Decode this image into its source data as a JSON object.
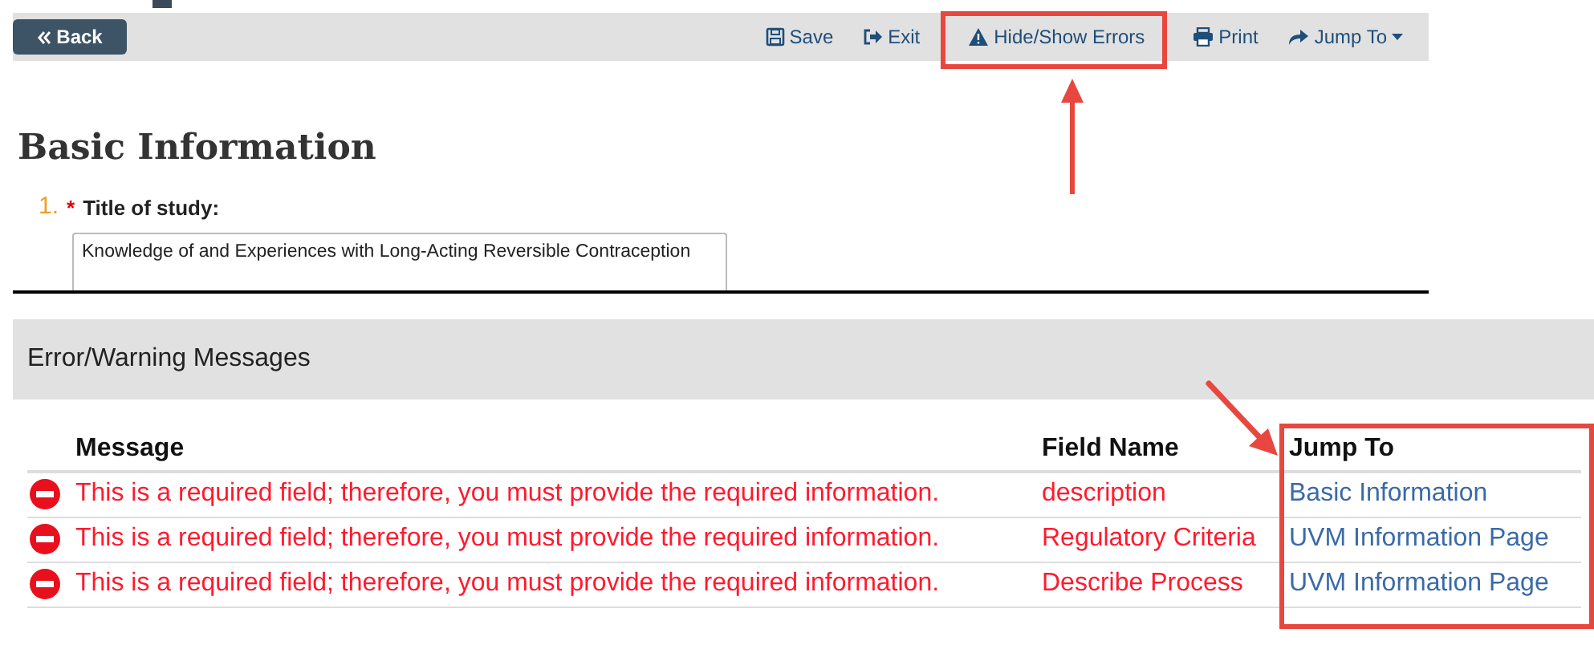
{
  "toolbar": {
    "back": "Back",
    "actions": [
      {
        "kind": "save",
        "label": "Save"
      },
      {
        "kind": "exit",
        "label": "Exit"
      },
      {
        "kind": "errors",
        "label": "Hide/Show Errors"
      },
      {
        "kind": "print",
        "label": "Print"
      },
      {
        "kind": "jump",
        "label": "Jump To"
      }
    ]
  },
  "page_title": "Basic Information",
  "question": {
    "number": "1.",
    "required_mark": "*",
    "label": "Title of study:",
    "value": "Knowledge of and Experiences with Long-Acting Reversible Contraception"
  },
  "messages_panel": {
    "title": "Error/Warning Messages",
    "columns": [
      "Message",
      "Field Name",
      "Jump To"
    ],
    "rows": [
      {
        "message": "This is a required field; therefore, you must provide the required information.",
        "field": "description",
        "jump_to": "Basic Information"
      },
      {
        "message": "This is a required field; therefore, you must provide the required information.",
        "field": "Regulatory Criteria",
        "jump_to": "UVM Information Page"
      },
      {
        "message": "This is a required field; therefore, you must provide the required information.",
        "field": "Describe Process",
        "jump_to": "UVM Information Page"
      }
    ]
  }
}
